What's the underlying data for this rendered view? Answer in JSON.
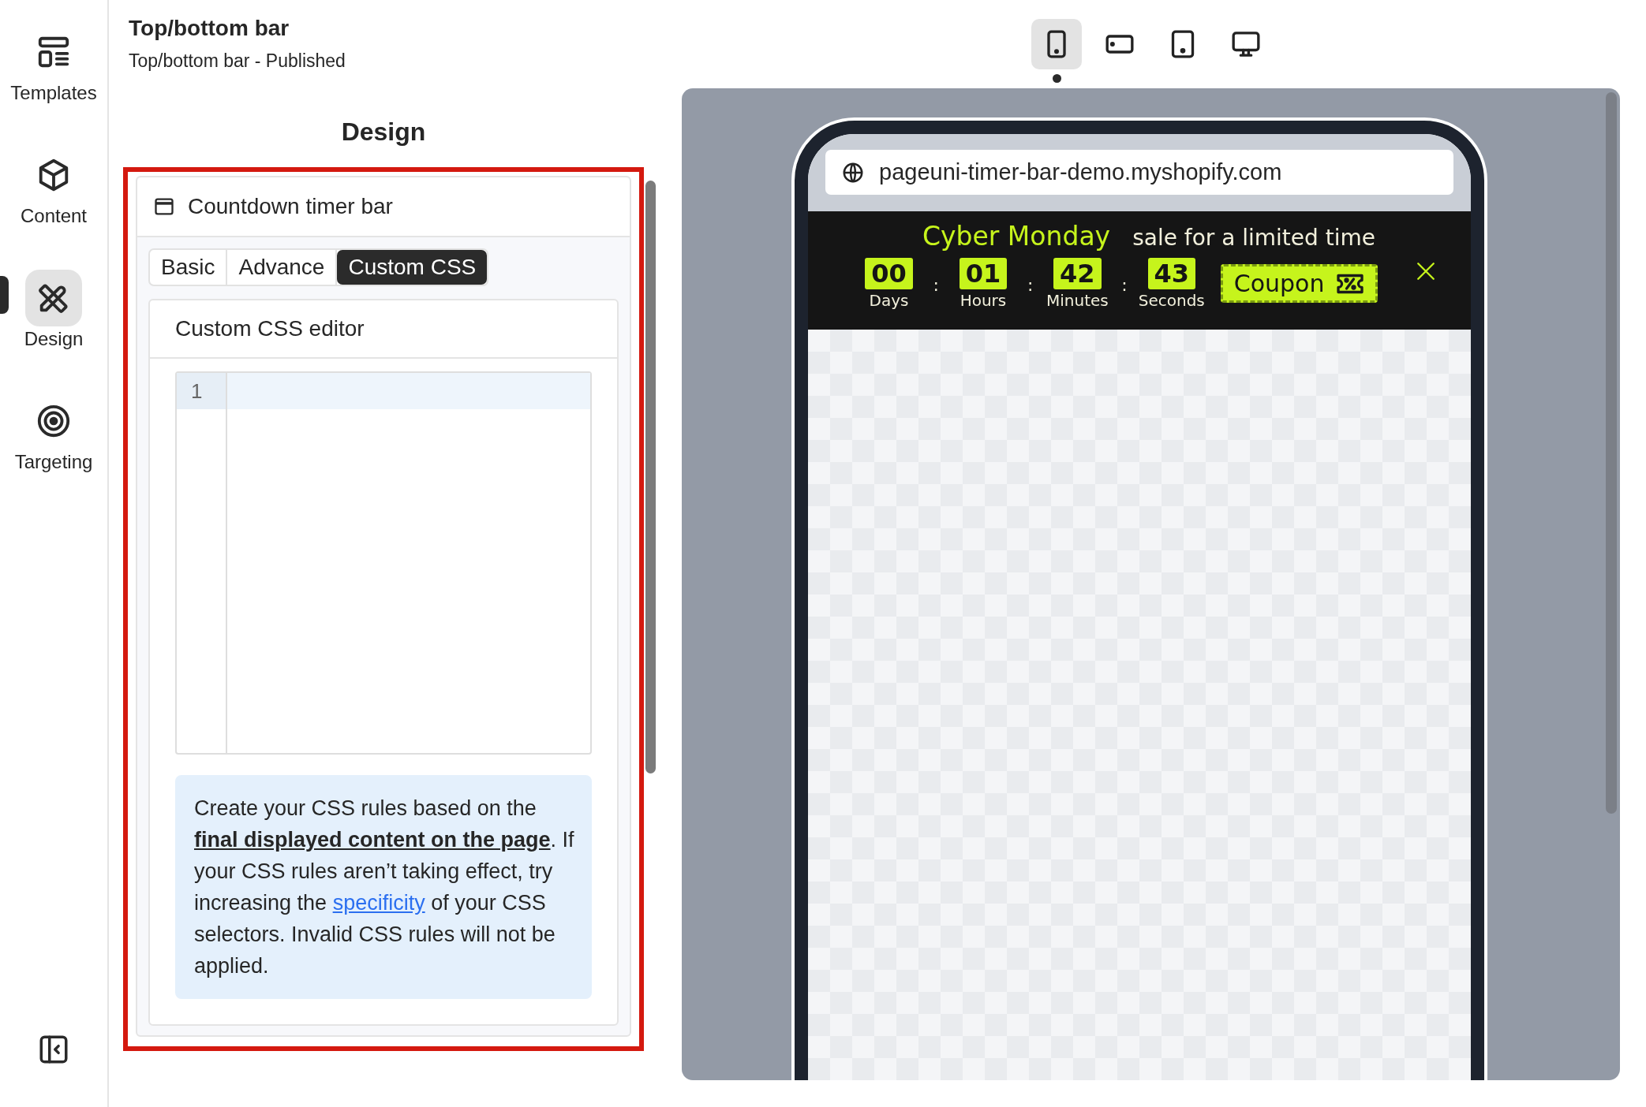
{
  "nav": {
    "items": [
      {
        "kind": "templates",
        "label": "Templates",
        "selected": false
      },
      {
        "kind": "content",
        "label": "Content",
        "selected": false
      },
      {
        "kind": "design",
        "label": "Design",
        "selected": true
      },
      {
        "kind": "targeting",
        "label": "Targeting",
        "selected": false
      }
    ]
  },
  "header": {
    "title": "Top/bottom bar",
    "subtitle": "Top/bottom bar - Published"
  },
  "panel": {
    "heading": "Design",
    "card": {
      "title": "Countdown timer bar",
      "tabs": [
        {
          "label": "Basic",
          "selected": false
        },
        {
          "label": "Advance",
          "selected": false
        },
        {
          "label": "Custom CSS",
          "selected": true
        }
      ],
      "editor": {
        "title": "Custom CSS editor",
        "line_numbers": [
          "1"
        ]
      },
      "info": {
        "text_before": "Create your CSS rules based on the **final displayed content on the page**. If your CSS rules aren’t taking effect, try increasing the",
        "link": "specificity",
        "text_after": "of your CSS selectors. Invalid CSS rules will not be applied."
      }
    }
  },
  "preview": {
    "devices": [
      {
        "kind": "phone",
        "selected": true
      },
      {
        "kind": "phone-landscape",
        "selected": false
      },
      {
        "kind": "tablet",
        "selected": false
      },
      {
        "kind": "desktop",
        "selected": false
      }
    ],
    "url": "pageuni-timer-bar-demo.myshopify.com",
    "bar": {
      "headline_highlight": "Cyber Monday",
      "headline": "sale for a limited time",
      "timer": [
        {
          "value": "00",
          "label": "Days"
        },
        {
          "value": "01",
          "label": "Hours"
        },
        {
          "value": "42",
          "label": "Minutes"
        },
        {
          "value": "43",
          "label": "Seconds"
        }
      ],
      "separator": ":",
      "coupon": "Coupon"
    }
  }
}
